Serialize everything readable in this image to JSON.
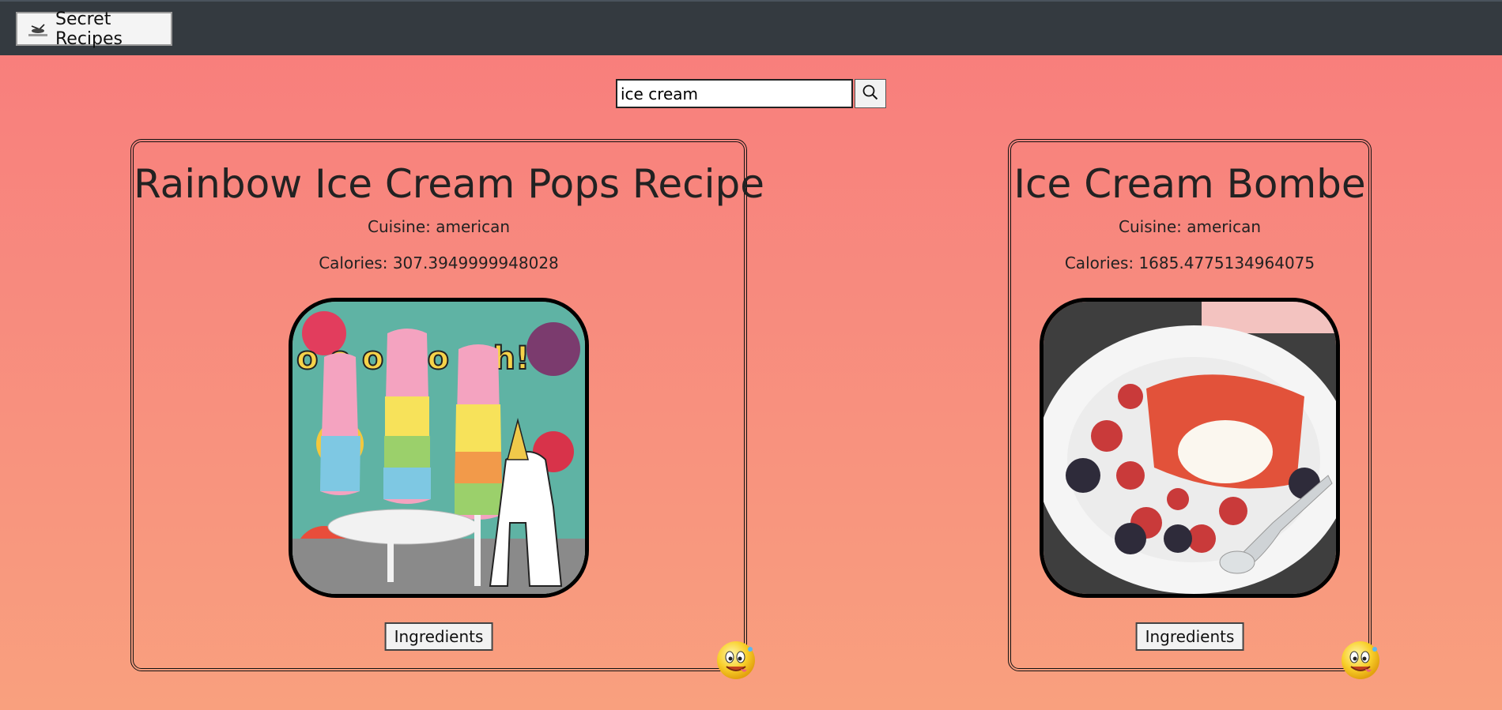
{
  "nav": {
    "brand_label": "Secret Recipes",
    "logo_icon": "cooking-logo-icon",
    "background": "#343a40"
  },
  "search": {
    "value": "ice cream",
    "button_icon": "search-icon"
  },
  "recipes": [
    {
      "title": "Rainbow Ice Cream Pops Recipe",
      "cuisine": "Cuisine: american",
      "calories": "Calories: 307.3949999948028",
      "ingredients_label": "Ingredients",
      "reaction_icon": "yum-emoji-icon"
    },
    {
      "title": "Ice Cream Bombe",
      "cuisine": "Cuisine: american",
      "calories": "Calories: 1685.4775134964075",
      "ingredients_label": "Ingredients",
      "reaction_icon": "yum-emoji-icon"
    }
  ],
  "colors": {
    "background_top": "#f97c7c",
    "background_bottom": "#f9a07e"
  }
}
